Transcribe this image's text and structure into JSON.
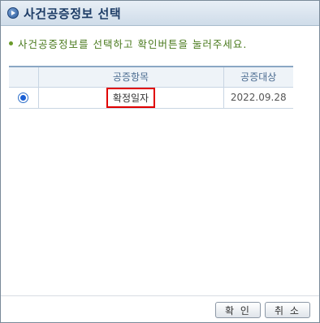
{
  "dialog": {
    "title": "사건공증정보 선택",
    "instruction": "사건공증정보를 선택하고 확인버튼을 눌러주세요."
  },
  "table": {
    "headers": [
      "",
      "공증항목",
      "공증대상"
    ],
    "rows": [
      {
        "selected": true,
        "item": "확정일자",
        "target": "2022.09.28"
      }
    ]
  },
  "buttons": {
    "ok_label": "확 인",
    "cancel_label": "취 소"
  },
  "colors": {
    "highlight_border": "#e00000",
    "instruction_text": "#4a7a1e",
    "title_text": "#1d3c66"
  }
}
